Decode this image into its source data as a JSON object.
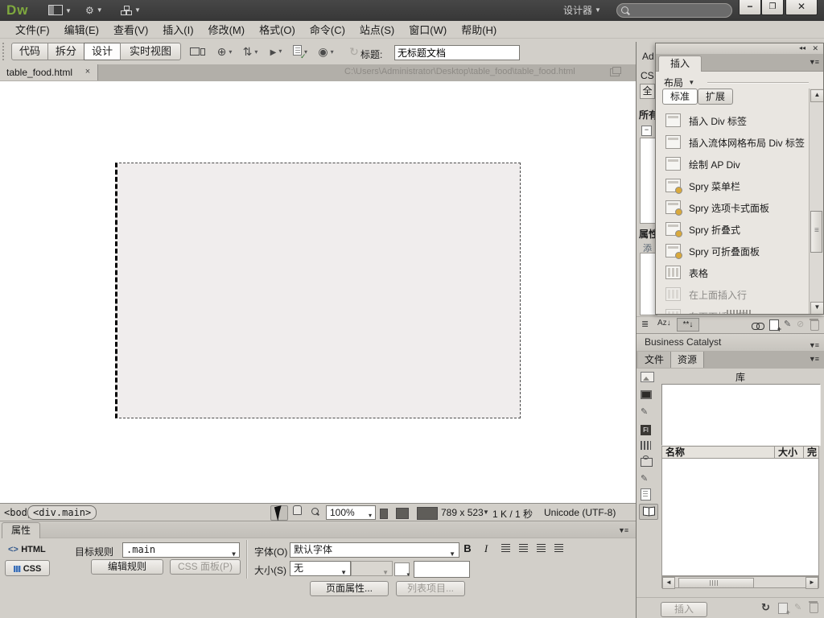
{
  "titlebar": {
    "logo": "Dw",
    "workspace": "设计器",
    "minimize": "−",
    "restore": "❐",
    "close": "✕"
  },
  "menus": [
    "文件(F)",
    "编辑(E)",
    "查看(V)",
    "插入(I)",
    "修改(M)",
    "格式(O)",
    "命令(C)",
    "站点(S)",
    "窗口(W)",
    "帮助(H)"
  ],
  "toolbar": {
    "views": [
      "代码",
      "拆分",
      "设计",
      "实时视图"
    ],
    "title_label": "标题:",
    "title_value": "无标题文档",
    "icon_glyphs": {
      "browser": "⊕",
      "filemgmt": "⇅",
      "live": "▶",
      "check": "✓",
      "eye": "◉",
      "refresh": "↻"
    }
  },
  "tabbar": {
    "file": "table_food.html",
    "close": "×",
    "path": "C:\\Users\\Administrator\\Desktop\\table_food\\table_food.html"
  },
  "statusbar": {
    "tag_body": "<body>",
    "tag_div": "<div.main>",
    "zoom": "100%",
    "dims": "789 x 523",
    "stats": "1 K / 1 秒",
    "encoding": "Unicode (UTF-8)"
  },
  "properties": {
    "tab": "属性",
    "html_label": "HTML",
    "html_glyph": "<>",
    "css_label": "CSS",
    "target_rule_label": "目标规则",
    "target_rule_value": ".main",
    "edit_rule": "编辑规则",
    "css_panel": "CSS 面板(P)",
    "font_label": "字体(O)",
    "font_value": "默认字体",
    "bold": "B",
    "italic": "I",
    "size_label": "大小(S)",
    "size_value": "无",
    "page_props": "页面属性...",
    "list_items": "列表项目..."
  },
  "css_sliver": {
    "tab_ad": "Ad",
    "tab_cs": "CS",
    "all_btn": "全",
    "all_rules": "所有",
    "expand_box": "−",
    "props": "属性",
    "add": "添",
    "sort_az": "Az↓",
    "show_set": "**↓"
  },
  "business_catalyst": "Business Catalyst",
  "dock_tabs": {
    "files": "文件",
    "assets": "资源"
  },
  "assets": {
    "title": "库",
    "col_name": "名称",
    "col_size": "大小",
    "col_full": "完",
    "insert_btn": "插入",
    "flash_label": "Fl",
    "refresh_glyph": "↻"
  },
  "insert_panel": {
    "collapse": "◂◂",
    "close": "✕",
    "tab": "插入",
    "category": "布局",
    "mode_standard": "标准",
    "mode_expanded": "扩展",
    "items": [
      "插入 Div 标签",
      "插入流体网格布局 Div 标签",
      "绘制 AP Div",
      "Spry 菜单栏",
      "Spry 选项卡式面板",
      "Spry 折叠式",
      "Spry 可折叠面板",
      "表格",
      "在上面插入行",
      "在下面插入行"
    ],
    "scroll_up": "▲",
    "scroll_down": "▼"
  }
}
